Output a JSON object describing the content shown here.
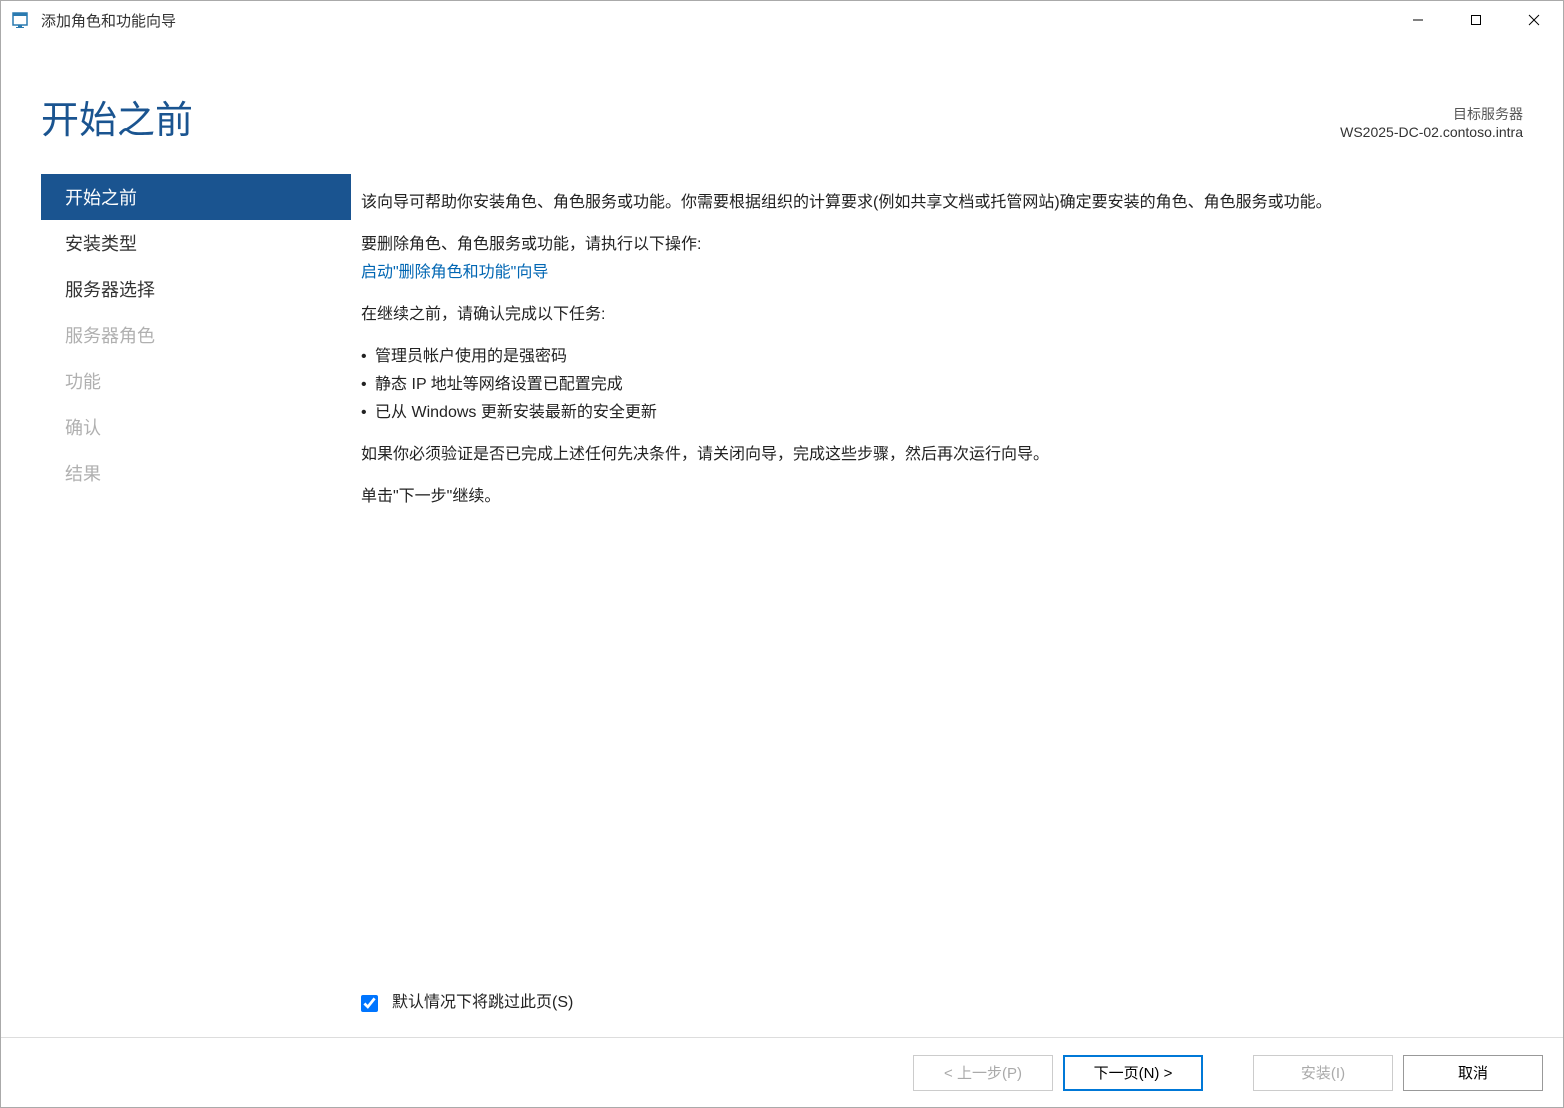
{
  "window": {
    "title": "添加角色和功能向导"
  },
  "header": {
    "page_title": "开始之前",
    "target_label": "目标服务器",
    "target_name": "WS2025-DC-02.contoso.intra"
  },
  "sidebar": {
    "items": [
      {
        "label": "开始之前",
        "state": "selected"
      },
      {
        "label": "安装类型",
        "state": "enabled"
      },
      {
        "label": "服务器选择",
        "state": "enabled"
      },
      {
        "label": "服务器角色",
        "state": "disabled"
      },
      {
        "label": "功能",
        "state": "disabled"
      },
      {
        "label": "确认",
        "state": "disabled"
      },
      {
        "label": "结果",
        "state": "disabled"
      }
    ]
  },
  "main": {
    "intro": "该向导可帮助你安装角色、角色服务或功能。你需要根据组织的计算要求(例如共享文档或托管网站)确定要安装的角色、角色服务或功能。",
    "remove_intro": "要删除角色、角色服务或功能，请执行以下操作:",
    "remove_link": "启动\"删除角色和功能\"向导",
    "verify_intro": "在继续之前，请确认完成以下任务:",
    "bullets": [
      "管理员帐户使用的是强密码",
      "静态 IP 地址等网络设置已配置完成",
      "已从 Windows 更新安装最新的安全更新"
    ],
    "verify_note": "如果你必须验证是否已完成上述任何先决条件，请关闭向导，完成这些步骤，然后再次运行向导。",
    "continue_note": "单击\"下一步\"继续。",
    "skip_checkbox_label": "默认情况下将跳过此页(S)",
    "skip_checked": true
  },
  "footer": {
    "previous": "< 上一步(P)",
    "next": "下一页(N) >",
    "install": "安装(I)",
    "cancel": "取消"
  }
}
